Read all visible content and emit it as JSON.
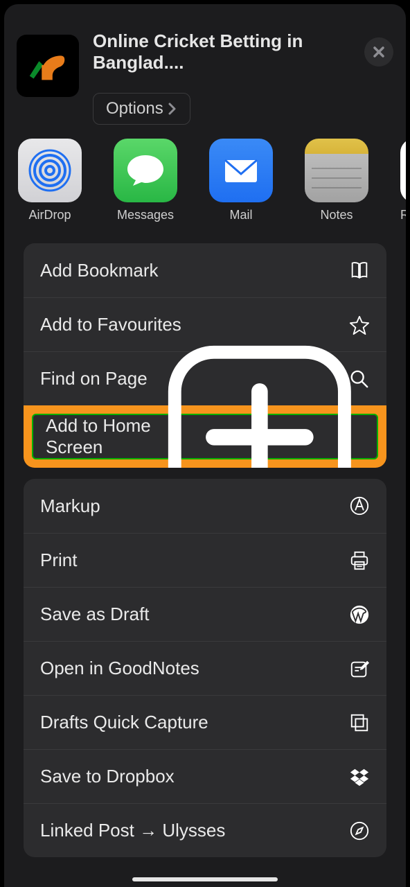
{
  "header": {
    "title": "Online Cricket Betting in Banglad....",
    "options_label": "Options"
  },
  "share_apps": [
    {
      "id": "airdrop",
      "label": "AirDrop"
    },
    {
      "id": "messages",
      "label": "Messages"
    },
    {
      "id": "mail",
      "label": "Mail"
    },
    {
      "id": "notes",
      "label": "Notes"
    },
    {
      "id": "reminders",
      "label": "Re"
    }
  ],
  "actions_group1": [
    {
      "id": "bookmark",
      "label": "Add Bookmark",
      "icon": "book"
    },
    {
      "id": "favourites",
      "label": "Add to Favourites",
      "icon": "star"
    },
    {
      "id": "find",
      "label": "Find on Page",
      "icon": "search"
    },
    {
      "id": "homescreen",
      "label": "Add to Home Screen",
      "icon": "plus-square",
      "highlighted": true
    }
  ],
  "actions_group2": [
    {
      "id": "markup",
      "label": "Markup",
      "icon": "markup"
    },
    {
      "id": "print",
      "label": "Print",
      "icon": "print"
    },
    {
      "id": "save-draft",
      "label": "Save as Draft",
      "icon": "wordpress"
    },
    {
      "id": "goodnotes",
      "label": "Open in GoodNotes",
      "icon": "compose"
    },
    {
      "id": "drafts-capture",
      "label": "Drafts Quick Capture",
      "icon": "copy"
    },
    {
      "id": "dropbox",
      "label": "Save to Dropbox",
      "icon": "dropbox"
    },
    {
      "id": "ulysses",
      "label": "Linked Post → Ulysses",
      "icon": "compass"
    }
  ]
}
